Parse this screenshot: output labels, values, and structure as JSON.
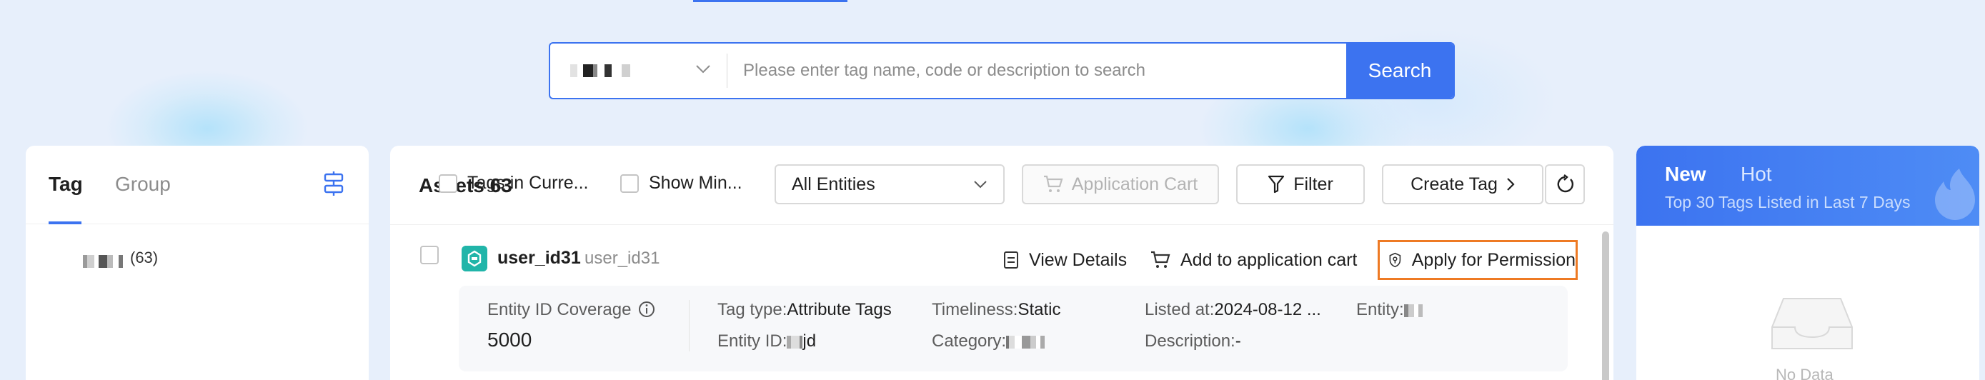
{
  "search": {
    "placeholder": "Please enter tag name, code or description to search",
    "button_label": "Search"
  },
  "left_panel": {
    "tabs": [
      {
        "label": "Tag"
      },
      {
        "label": "Group"
      }
    ],
    "tree": [
      {
        "count": "(63)"
      }
    ]
  },
  "toolbar": {
    "title": "Assets",
    "title_count": "63",
    "checkbox_current": "Tags in Curre...",
    "checkbox_min": "Show Min...",
    "entity_select": "All Entities",
    "cart_button": "Application Cart",
    "filter_button": "Filter",
    "create_button": "Create Tag"
  },
  "tag_row": {
    "name": "user_id31",
    "code": "user_id31",
    "actions": {
      "view": "View Details",
      "add_cart": "Add to application cart",
      "apply": "Apply for Permission"
    },
    "details": {
      "coverage_label": "Entity ID Coverage",
      "coverage_value": "5000",
      "tag_type_label": "Tag type:",
      "tag_type_value": "Attribute Tags",
      "entity_id_label": "Entity ID:",
      "entity_id_value": "jd",
      "timeliness_label": "Timeliness:",
      "timeliness_value": "Static",
      "category_label": "Category:",
      "listed_label": "Listed at:",
      "listed_value": "2024-08-12 ...",
      "description_label": "Description:",
      "description_value": "-",
      "entity_label": "Entity:"
    }
  },
  "right_panel": {
    "tab_new": "New",
    "tab_hot": "Hot",
    "subtitle": "Top 30 Tags Listed in Last 7 Days",
    "empty_text": "No Data"
  },
  "colors": {
    "accent": "#3c73f0",
    "highlight": "#ee7a24",
    "tag_icon": "#21b5a9",
    "background": "#e7effb"
  },
  "icons": [
    "chevron-down-icon",
    "settings-sliders-icon",
    "tag-icon",
    "document-icon",
    "cart-icon",
    "shield-icon",
    "info-icon",
    "filter-icon",
    "chevron-right-icon",
    "refresh-icon",
    "flame-icon",
    "empty-inbox-icon"
  ]
}
